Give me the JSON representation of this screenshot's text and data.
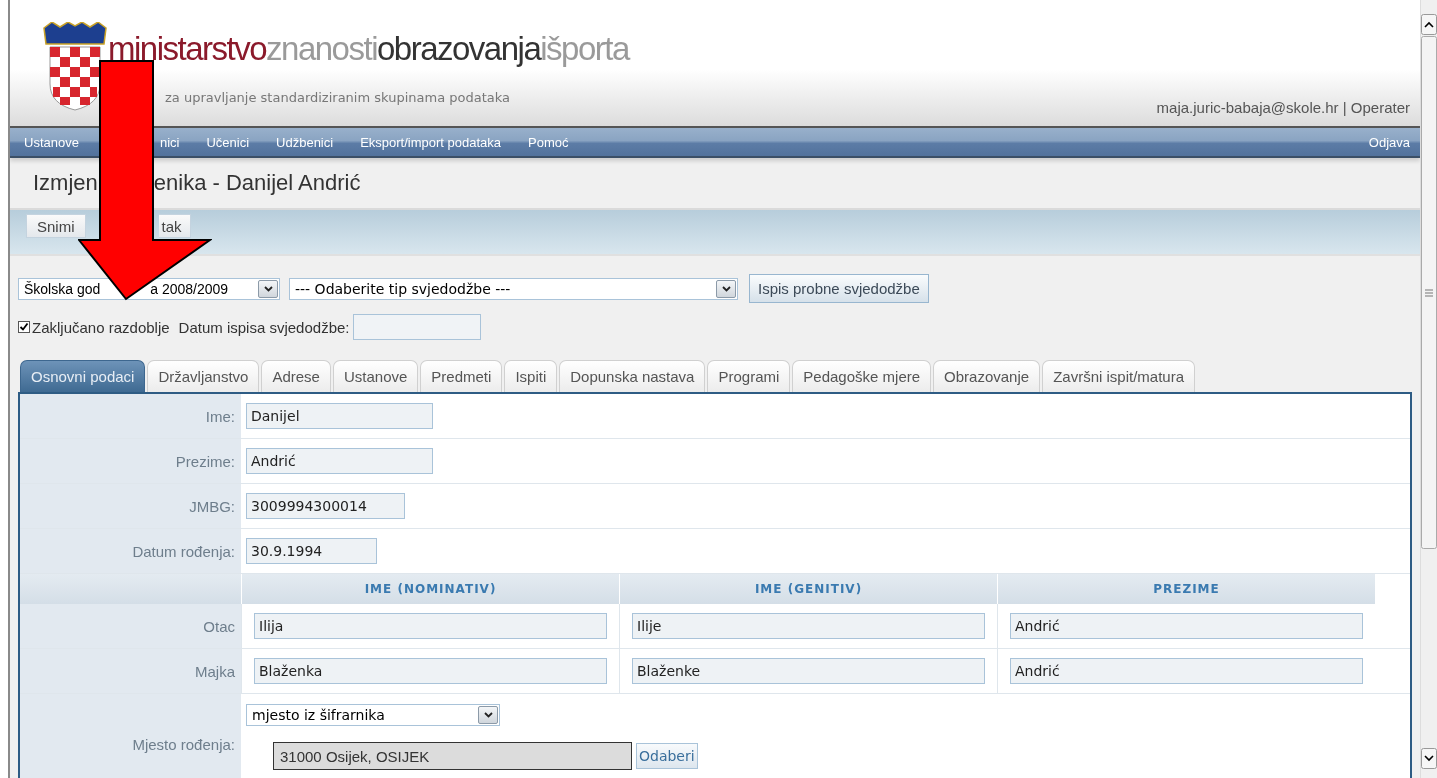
{
  "header": {
    "logo_parts": [
      "ministarstvo",
      "znanosti",
      "obrazovanja",
      "išporta"
    ],
    "subtitle": "za upravljanje standardiziranim skupinama podataka",
    "user": "maja.juric-babaja@skole.hr | Operater"
  },
  "nav": {
    "items": [
      {
        "label": "Ustanove"
      },
      {
        "label": "nici"
      },
      {
        "label": "Učenici"
      },
      {
        "label": "Udžbenici"
      },
      {
        "label": "Eksport/import podataka"
      },
      {
        "label": "Pomoć"
      }
    ],
    "logout": "Odjava"
  },
  "title_parts": [
    "Izmjen",
    "enika - Danijel Andrić"
  ],
  "toolbar": {
    "buttons": [
      "Snimi",
      "tak"
    ]
  },
  "filters": {
    "year_select_parts": [
      "Školska god",
      "a 2008/2009"
    ],
    "certificate_select": "--- Odaberite tip svjedodžbe ---",
    "print_button": "Ispis probne svjedodžbe",
    "locked": {
      "label": "Zaključano razdoblje",
      "checked": true
    },
    "print_date": {
      "label": "Datum ispisa svjedodžbe:"
    }
  },
  "tabs": [
    {
      "label": "Osnovni podaci",
      "selected": true
    },
    {
      "label": "Državljanstvo",
      "selected": false
    },
    {
      "label": "Adrese",
      "selected": false
    },
    {
      "label": "Ustanove",
      "selected": false
    },
    {
      "label": "Predmeti",
      "selected": false
    },
    {
      "label": "Ispiti",
      "selected": false
    },
    {
      "label": "Dopunska nastava",
      "selected": false
    },
    {
      "label": "Programi",
      "selected": false
    },
    {
      "label": "Pedagoške mjere",
      "selected": false
    },
    {
      "label": "Obrazovanje",
      "selected": false
    },
    {
      "label": "Završni ispit/matura",
      "selected": false
    }
  ],
  "form": {
    "fields": [
      {
        "label": "Ime:",
        "value": "Danijel"
      },
      {
        "label": "Prezime:",
        "value": "Andrić"
      },
      {
        "label": "JMBG:",
        "value": "3009994300014"
      },
      {
        "label": "Datum rođenja:",
        "value": "30.9.1994"
      }
    ],
    "parents": {
      "columns": [
        "IME (NOMINATIV)",
        "IME (GENITIV)",
        "PREZIME"
      ],
      "rows": [
        {
          "label": "Otac",
          "values": [
            "Ilija",
            "Ilije",
            "Andrić"
          ]
        },
        {
          "label": "Majka",
          "values": [
            "Blaženka",
            "Blaženke",
            "Andrić"
          ]
        }
      ]
    },
    "birthplace": {
      "label": "Mjesto rođenja:",
      "select": "mjesto iz šifrarnika",
      "value": "31000 Osijek, OSIJEK",
      "button": "Odaberi"
    }
  }
}
